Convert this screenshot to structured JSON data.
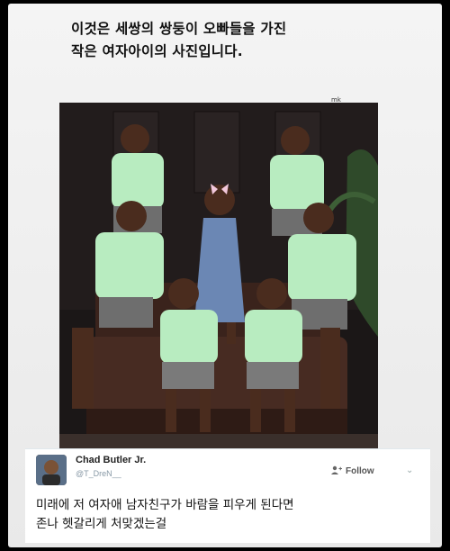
{
  "caption": {
    "line1": "이것은 세쌍의 쌍둥이 오빠들을 가진",
    "line2": "작은 여자아이의 사진입니다."
  },
  "watermark": "mk",
  "tweet": {
    "name": "Chad Butler Jr.",
    "handle": "@T_DreN__",
    "follow_label": "Follow",
    "follow_icon": "add-person-icon",
    "menu_icon": "chevron-down-icon",
    "text_line1": "미래에 저 여자애 남자친구가 바람을 피우게 된다면",
    "text_line2": "존나 헷갈리게 처맞겠는걸"
  },
  "colors": {
    "background": "#000000",
    "card": "#f0f0f0",
    "shirt_green": "#b8ecc0",
    "photo_backdrop": "#1a1616"
  }
}
